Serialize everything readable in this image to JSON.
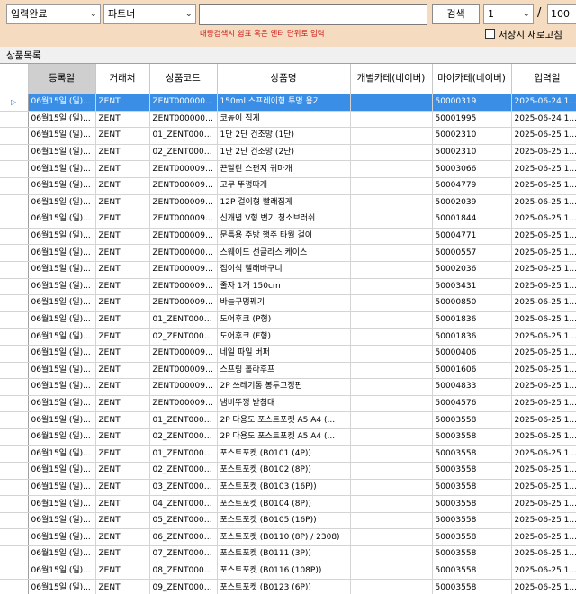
{
  "toolbar": {
    "status_select": "입력완료",
    "partner_select": "파트너",
    "search_value": "",
    "search_button": "검색",
    "page_current": "1",
    "page_separator": "/",
    "page_total": "100",
    "hint": "대량검색시 쉼표 혹은 엔터 단위로 입력",
    "save_checkbox_label": "저장시 새로고침",
    "save_checkbox_checked": false
  },
  "section_title": "상품목록",
  "table": {
    "columns": [
      "등록일",
      "거래처",
      "상품코드",
      "상품명",
      "개별카테(네이버)",
      "마이카테(네이버)",
      "입력일"
    ],
    "sorted_column": 0,
    "selected_row": 0,
    "rows": [
      [
        "06월15일 (일)...",
        "ZENT",
        "ZENT00000098",
        "150ml 스프레이형 투명 용기",
        "",
        "50000319",
        "2025-06-24 1..."
      ],
      [
        "06월15일 (일)...",
        "ZENT",
        "ZENT00000096",
        "코높이 집게",
        "",
        "50001995",
        "2025-06-24 1..."
      ],
      [
        "06월15일 (일)...",
        "ZENT",
        "01_ZENT0000...",
        "1단 2단 건조망 (1단)",
        "",
        "50002310",
        "2025-06-25 1..."
      ],
      [
        "06월15일 (일)...",
        "ZENT",
        "02_ZENT0000...",
        "1단 2단 건조망 (2단)",
        "",
        "50002310",
        "2025-06-25 1..."
      ],
      [
        "06월15일 (일)...",
        "ZENT",
        "ZENT00000957",
        "끈달린 스펀지 귀마개",
        "",
        "50003066",
        "2025-06-25 1..."
      ],
      [
        "06월15일 (일)...",
        "ZENT",
        "ZENT00000955",
        "고무 뚜껑따개",
        "",
        "50004779",
        "2025-06-25 1..."
      ],
      [
        "06월15일 (일)...",
        "ZENT",
        "ZENT00000953",
        "12P 걸이형 빨래집게",
        "",
        "50002039",
        "2025-06-25 1..."
      ],
      [
        "06월15일 (일)...",
        "ZENT",
        "ZENT00000952",
        "신개념 V형 변기 청소브러쉬",
        "",
        "50001844",
        "2025-06-25 1..."
      ],
      [
        "06월15일 (일)...",
        "ZENT",
        "ZENT00000951",
        "문틈용 주방 행주 타월 걸이",
        "",
        "50004771",
        "2025-06-25 1..."
      ],
      [
        "06월15일 (일)...",
        "ZENT",
        "ZENT00000095",
        "스웨이드 선글라스 케이스",
        "",
        "50000557",
        "2025-06-25 1..."
      ],
      [
        "06월15일 (일)...",
        "ZENT",
        "ZENT00000948",
        "접이식 빨래바구니",
        "",
        "50002036",
        "2025-06-25 1..."
      ],
      [
        "06월15일 (일)...",
        "ZENT",
        "ZENT00000947",
        "줄자 1개 150cm",
        "",
        "50003431",
        "2025-06-25 1..."
      ],
      [
        "06월15일 (일)...",
        "ZENT",
        "ZENT00000946",
        "바늘구멍꿰기",
        "",
        "50000850",
        "2025-06-25 1..."
      ],
      [
        "06월15일 (일)...",
        "ZENT",
        "01_ZENT0000...",
        "도어후크 (P형)",
        "",
        "50001836",
        "2025-06-25 1..."
      ],
      [
        "06월15일 (일)...",
        "ZENT",
        "02_ZENT0000...",
        "도어후크 (F형)",
        "",
        "50001836",
        "2025-06-25 1..."
      ],
      [
        "06월15일 (일)...",
        "ZENT",
        "ZENT00000944",
        "네일 파일 버퍼",
        "",
        "50000406",
        "2025-06-25 1..."
      ],
      [
        "06월15일 (일)...",
        "ZENT",
        "ZENT00000942",
        "스프링 홀라후프",
        "",
        "50001606",
        "2025-06-25 1..."
      ],
      [
        "06월15일 (일)...",
        "ZENT",
        "ZENT00000941",
        "2P 쓰레기통 봉투고정핀",
        "",
        "50004833",
        "2025-06-25 1..."
      ],
      [
        "06월15일 (일)...",
        "ZENT",
        "ZENT00000939",
        "냄비뚜껑 받침대",
        "",
        "50004576",
        "2025-06-25 1..."
      ],
      [
        "06월15일 (일)...",
        "ZENT",
        "01_ZENT0000...",
        "2P 다용도 포스트포켓 A5 A4 (...",
        "",
        "50003558",
        "2025-06-25 1..."
      ],
      [
        "06월15일 (일)...",
        "ZENT",
        "02_ZENT0000...",
        "2P 다용도 포스트포켓 A5 A4 (...",
        "",
        "50003558",
        "2025-06-25 1..."
      ],
      [
        "06월15일 (일)...",
        "ZENT",
        "01_ZENT0000...",
        "포스트포켓 (B0101 (4P))",
        "",
        "50003558",
        "2025-06-25 1..."
      ],
      [
        "06월15일 (일)...",
        "ZENT",
        "02_ZENT0000...",
        "포스트포켓 (B0102 (8P))",
        "",
        "50003558",
        "2025-06-25 1..."
      ],
      [
        "06월15일 (일)...",
        "ZENT",
        "03_ZENT0000...",
        "포스트포켓 (B0103 (16P))",
        "",
        "50003558",
        "2025-06-25 1..."
      ],
      [
        "06월15일 (일)...",
        "ZENT",
        "04_ZENT0000...",
        "포스트포켓 (B0104 (8P))",
        "",
        "50003558",
        "2025-06-25 1..."
      ],
      [
        "06월15일 (일)...",
        "ZENT",
        "05_ZENT0000...",
        "포스트포켓 (B0105 (16P))",
        "",
        "50003558",
        "2025-06-25 1..."
      ],
      [
        "06월15일 (일)...",
        "ZENT",
        "06_ZENT0000...",
        "포스트포켓 (B0110 (8P) / 2308)",
        "",
        "50003558",
        "2025-06-25 1..."
      ],
      [
        "06월15일 (일)...",
        "ZENT",
        "07_ZENT0000...",
        "포스트포켓 (B0111 (3P))",
        "",
        "50003558",
        "2025-06-25 1..."
      ],
      [
        "06월15일 (일)...",
        "ZENT",
        "08_ZENT0000...",
        "포스트포켓 (B0116 (108P))",
        "",
        "50003558",
        "2025-06-25 1..."
      ],
      [
        "06월15일 (일)...",
        "ZENT",
        "09_ZENT0000...",
        "포스트포켓 (B0123 (6P))",
        "",
        "50003558",
        "2025-06-25 1..."
      ]
    ]
  },
  "icons": {
    "dropdown": "chevron-down-icon",
    "row_indicator": "triangle-right-icon"
  },
  "colors": {
    "toolbar_bg": "#f5dcc0",
    "selection": "#3a8ee6",
    "hint": "#d02020"
  }
}
